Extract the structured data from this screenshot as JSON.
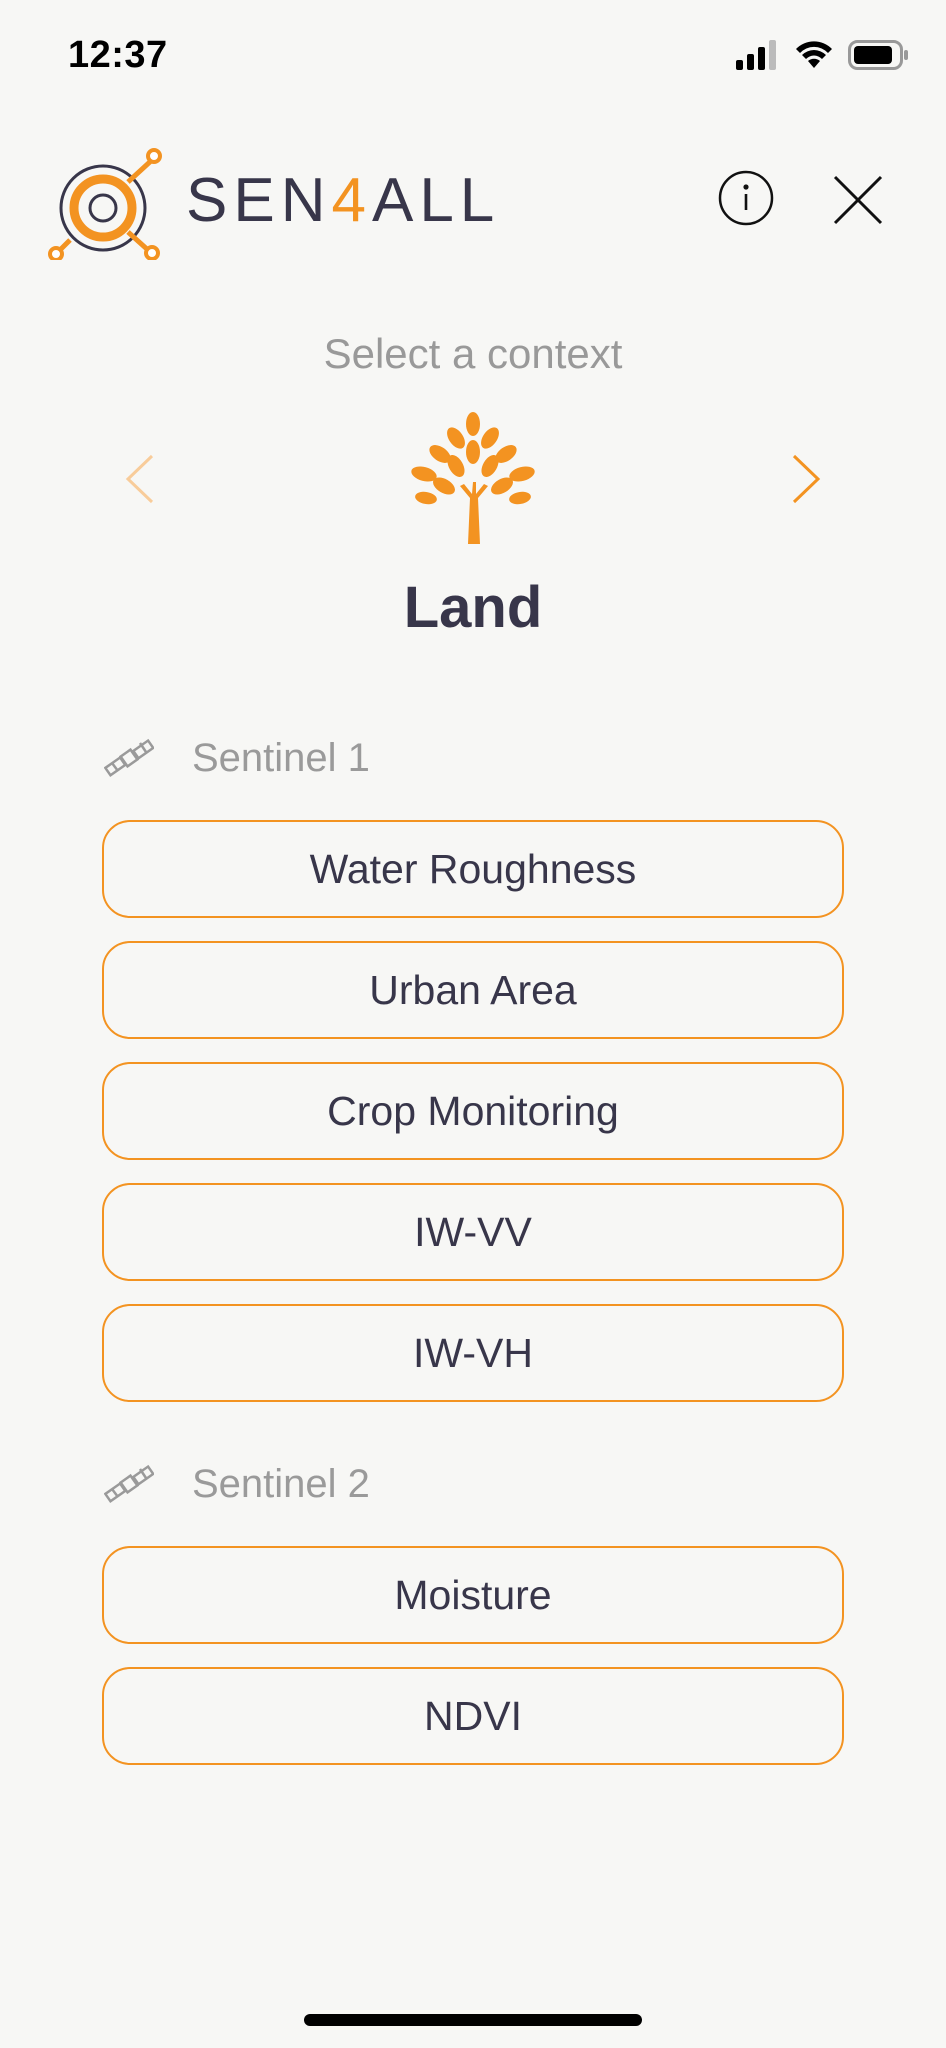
{
  "status_bar": {
    "time": "12:37"
  },
  "header": {
    "logo": {
      "text_prefix": "SEN",
      "text_accent": "4",
      "text_suffix": "ALL"
    },
    "info_icon": "info-icon",
    "close_icon": "close-icon"
  },
  "context": {
    "title": "Select a context",
    "name": "Land",
    "icon": "tree-icon"
  },
  "sections": [
    {
      "label": "Sentinel 1",
      "icon": "satellite-icon",
      "options": [
        "Water Roughness",
        "Urban Area",
        "Crop Monitoring",
        "IW-VV",
        "IW-VH"
      ]
    },
    {
      "label": "Sentinel 2",
      "icon": "satellite-icon",
      "options": [
        "Moisture",
        "NDVI"
      ]
    }
  ],
  "colors": {
    "accent": "#f39321",
    "text": "#38364a",
    "muted": "#999999",
    "background": "#f7f7f5"
  }
}
